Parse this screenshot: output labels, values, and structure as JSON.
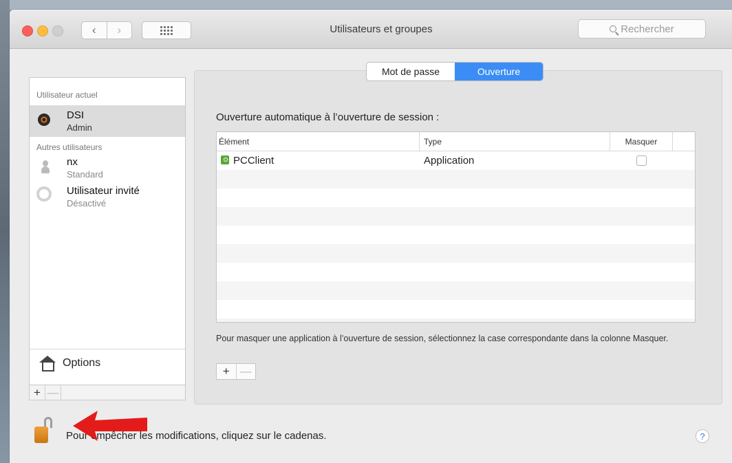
{
  "window": {
    "title": "Utilisateurs et groupes",
    "search_placeholder": "Rechercher",
    "nav_back_glyph": "‹",
    "nav_forward_glyph": "›"
  },
  "users": {
    "current_section": "Utilisateur actuel",
    "other_section": "Autres utilisateurs",
    "current_user": {
      "name": "DSI",
      "role": "Admin",
      "icon": "target-avatar-icon"
    },
    "others": [
      {
        "name": "nx",
        "role": "Standard",
        "icon": "person-icon"
      },
      {
        "name": "Utilisateur invité",
        "role": "Désactivé",
        "icon": "guest-icon"
      }
    ],
    "options_label": "Options",
    "add_glyph": "+",
    "remove_glyph": "—"
  },
  "tabs": [
    {
      "label": "Mot de passe",
      "active": false
    },
    {
      "label": "Ouverture",
      "active": true
    }
  ],
  "login_items": {
    "heading": "Ouverture automatique à l’ouverture de session :",
    "columns": [
      "Élément",
      "Type",
      "Masquer"
    ],
    "rows": [
      {
        "element": "PCClient",
        "type": "Application",
        "hidden": false
      }
    ],
    "hint": "Pour masquer une application à l’ouverture de session, sélectionnez la case correspondante dans la colonne Masquer."
  },
  "footer": {
    "lock_text": "Pour empêcher les modifications, cliquez sur le cadenas.",
    "help_glyph": "?"
  },
  "colors": {
    "accent_tab": "#3b8df5",
    "annotation_arrow": "#e41b1b",
    "lock": "#e08a20"
  }
}
